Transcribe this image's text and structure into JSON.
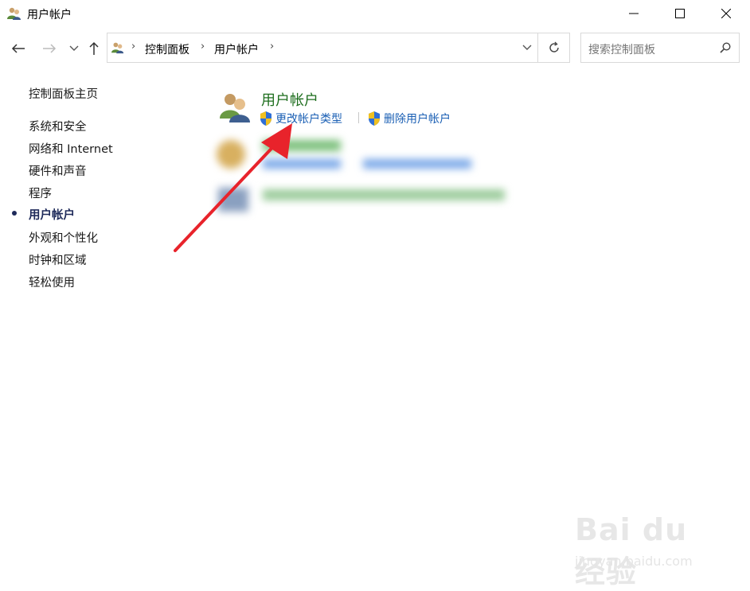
{
  "window": {
    "title": "用户帐户",
    "icon": "users-icon"
  },
  "navigation": {
    "back": "back-arrow-icon",
    "forward": "forward-arrow-icon",
    "recent": "chevron-down-icon",
    "up": "up-arrow-icon"
  },
  "address": {
    "crumbs": [
      "控制面板",
      "用户帐户"
    ],
    "refresh": "refresh-icon"
  },
  "search": {
    "placeholder": "搜索控制面板"
  },
  "sidebar": {
    "home": "控制面板主页",
    "items": [
      {
        "label": "系统和安全",
        "active": false
      },
      {
        "label": "网络和 Internet",
        "active": false
      },
      {
        "label": "硬件和声音",
        "active": false
      },
      {
        "label": "程序",
        "active": false
      },
      {
        "label": "用户帐户",
        "active": true
      },
      {
        "label": "外观和个性化",
        "active": false
      },
      {
        "label": "时钟和区域",
        "active": false
      },
      {
        "label": "轻松使用",
        "active": false
      }
    ]
  },
  "main": {
    "section_title": "用户帐户",
    "tasks": [
      {
        "label": "更改帐户类型",
        "icon": "uac-shield-icon"
      },
      {
        "label": "删除用户帐户",
        "icon": "uac-shield-icon"
      }
    ]
  },
  "colors": {
    "section_title": "#1e6e1e",
    "link": "#1a5fb4",
    "active_nav": "#1e2a5a",
    "annotation_arrow": "#e8232b"
  },
  "watermark": {
    "main": "Bai du 经验",
    "sub": "jingyan.baidu.com"
  }
}
